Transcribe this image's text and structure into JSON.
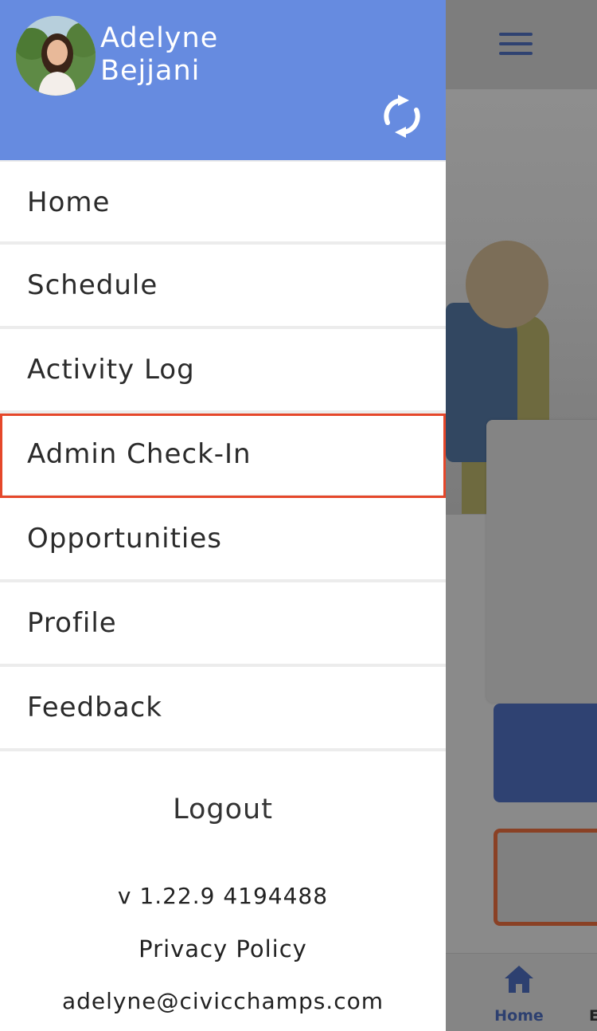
{
  "drawer": {
    "user_name": "Adelyne\nBejjani",
    "items": [
      {
        "label": "Home"
      },
      {
        "label": "Schedule"
      },
      {
        "label": "Activity Log"
      },
      {
        "label": "Admin Check-In",
        "highlighted": true
      },
      {
        "label": "Opportunities"
      },
      {
        "label": "Profile"
      },
      {
        "label": "Feedback"
      }
    ],
    "logout_label": "Logout",
    "version": "v 1.22.9 4194488",
    "privacy_label": "Privacy Policy",
    "email": "adelyne@civicchamps.com"
  },
  "tabbar": {
    "home_label": "Home",
    "next_label_partial": "E"
  },
  "colors": {
    "drawer_header": "#668be0",
    "highlight_outline": "#e5472a",
    "primary_dark": "#2f4272"
  },
  "icons": {
    "menu": "hamburger-menu-icon",
    "sync": "sync-icon",
    "home_tab": "home-icon"
  }
}
